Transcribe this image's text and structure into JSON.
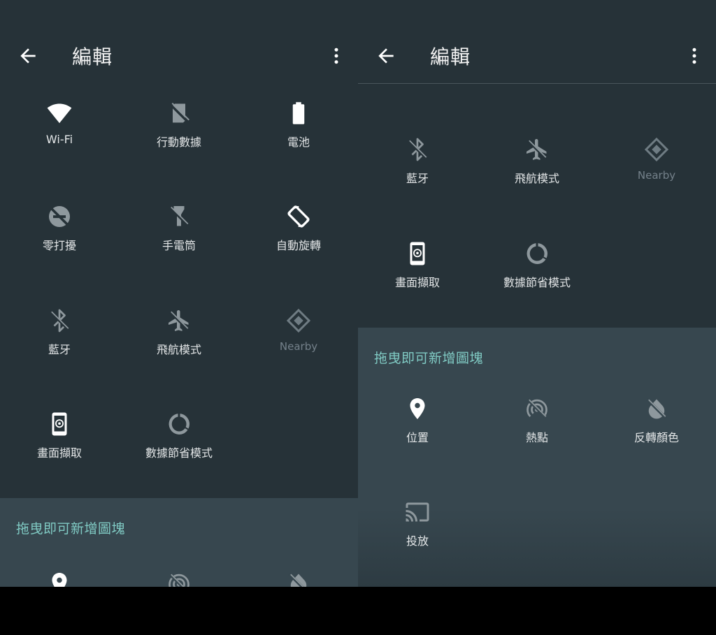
{
  "app": {
    "title": "編輯"
  },
  "tiles": {
    "wifi": "Wi-Fi",
    "cellular": "行動數據",
    "battery": "電池",
    "dnd": "零打擾",
    "flashlight": "手電筒",
    "autorotate": "自動旋轉",
    "bluetooth": "藍牙",
    "airplane": "飛航模式",
    "nearby": "Nearby",
    "screencap": "畫面擷取",
    "datasaver": "數據節省模式",
    "location": "位置",
    "hotspot": "熱點",
    "invert": "反轉顏色",
    "cast": "投放"
  },
  "drag_area": {
    "title": "拖曳即可新增圖塊"
  },
  "colors": {
    "background": "#263238",
    "drag_area": "#37474f",
    "accent": "#80cbc4",
    "text": "#e3e6e7"
  }
}
